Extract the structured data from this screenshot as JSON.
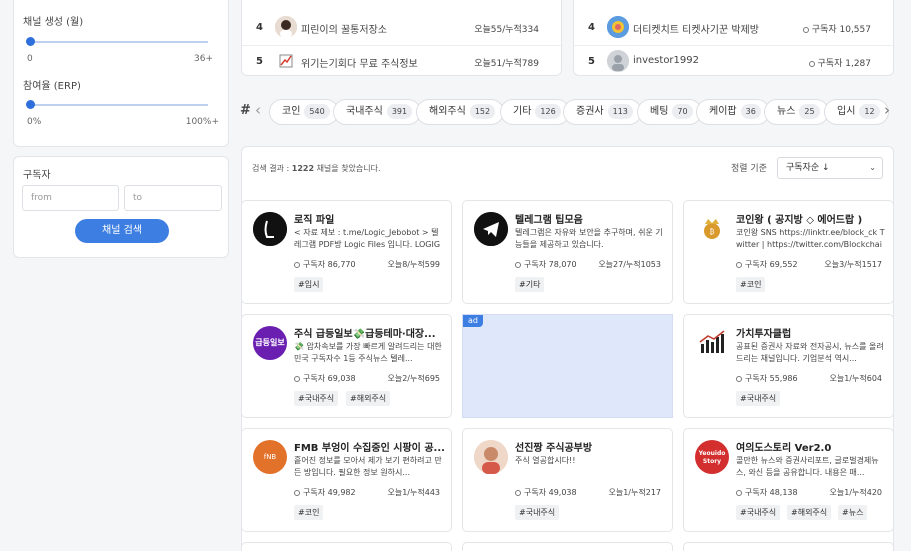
{
  "filters": {
    "creation_label": "채널 생성 (월)",
    "creation_min": "0",
    "creation_max": "36+",
    "participation_label": "참여율 (ERP)",
    "participation_min": "0%",
    "participation_max": "100%+",
    "subscribers_label": "구독자",
    "from_placeholder": "from",
    "to_placeholder": "to",
    "search_button": "채널 검색"
  },
  "ranking_left": [
    {
      "rank": "4",
      "name": "피린이의 꿀통저장소",
      "stats": "오늘55/누적334"
    },
    {
      "rank": "5",
      "name": "위기는기회다 무료 주식정보",
      "stats": "오늘51/누적789"
    }
  ],
  "ranking_right": [
    {
      "rank": "4",
      "name": "더티켓치트 티켓사기꾼 박제방",
      "stats": "구독자 10,557"
    },
    {
      "rank": "5",
      "name": "investor1992",
      "stats": "구독자 1,287"
    }
  ],
  "categories": {
    "hash_label": "#",
    "items": [
      {
        "label": "코인",
        "count": "540"
      },
      {
        "label": "국내주식",
        "count": "391"
      },
      {
        "label": "해외주식",
        "count": "152"
      },
      {
        "label": "기타",
        "count": "126"
      },
      {
        "label": "증권사",
        "count": "113"
      },
      {
        "label": "베팅",
        "count": "70"
      },
      {
        "label": "케이팝",
        "count": "36"
      },
      {
        "label": "뉴스",
        "count": "25"
      },
      {
        "label": "입시",
        "count": "12"
      }
    ]
  },
  "results": {
    "summary_prefix": "검색 결과 : ",
    "summary_count": "1222",
    "summary_suffix": " 채널을 찾았습니다.",
    "sort_label": "정렬 기준",
    "sort_value": "구독자순 ↓",
    "ad_label": "ad"
  },
  "cards": [
    {
      "title": "로직 파일",
      "desc": "< 자료 제보 : t.me/Logic_Jebobot > 텔레그램 PDF방 Logic Files 입니다. LOGIG ...",
      "subs": "구독자 86,770",
      "visits": "오늘8/누적599",
      "tags": [
        "#입시"
      ]
    },
    {
      "title": "텔레그램 팁모음",
      "desc": "텔레그램은 자유와 보안을 추구하며, 쉬운 기능들을 제공하고 있습니다.",
      "subs": "구독자 78,070",
      "visits": "오늘27/누적1053",
      "tags": [
        "#기타"
      ]
    },
    {
      "title": "코인왕 ( 공지방 ◇ 에어드랍 )",
      "desc": "코인왕 SNS https://linktr.ee/block_ck Twitter | https://twitter.com/Blockchain_C...",
      "subs": "구독자 69,552",
      "visits": "오늘3/누적1517",
      "tags": [
        "#코인"
      ]
    },
    {
      "title": "주식 급등일보💸급등테마·대장...",
      "desc": "💸 압차속보를 가장 빠르게 알려드리는 대한민국 구독자수 1등 주식뉴스 텔레...",
      "subs": "구독자 69,038",
      "visits": "오늘2/누적695",
      "tags": [
        "#국내주식",
        "#해외주식"
      ]
    },
    {
      "title": "가치투자클럽",
      "desc": "공표된 증권사 자료와 전자공시, 뉴스를 올려드리는 채널입니다. 기업분석 역시...",
      "subs": "구독자 55,986",
      "visits": "오늘1/누적604",
      "tags": [
        "#국내주식"
      ]
    },
    {
      "title": "FMB 부엉이 수집중인 시팡이 공...",
      "desc": "흩어진 정보를 모아서 제가 보기 편하려고 만든 방입니다. 필요한 정보 원하시...",
      "subs": "구독자 49,982",
      "visits": "오늘1/누적443",
      "tags": [
        "#코인"
      ]
    },
    {
      "title": "선진짱 주식공부방",
      "desc": "주식 열공합시다!!",
      "subs": "구독자 49,038",
      "visits": "오늘1/누적217",
      "tags": [
        "#국내주식"
      ]
    },
    {
      "title": "여의도스토리 Ver2.0",
      "desc": "콜만한 뉴스와 증권사리포트, 글로벌경제뉴스, 와신 등을 공유합니다. 내용은 매...",
      "subs": "구독자 48,138",
      "visits": "오늘1/누적420",
      "tags": [
        "#국내주식",
        "#해외주식",
        "#뉴스"
      ]
    }
  ],
  "logo_text": {
    "card4": "급등일보",
    "card6": "fNB",
    "card8_line1": "Yeouido",
    "card8_line2": "Story"
  },
  "colors": {
    "accent": "#3d7ee2",
    "ad_bg": "#dfe7fb"
  }
}
